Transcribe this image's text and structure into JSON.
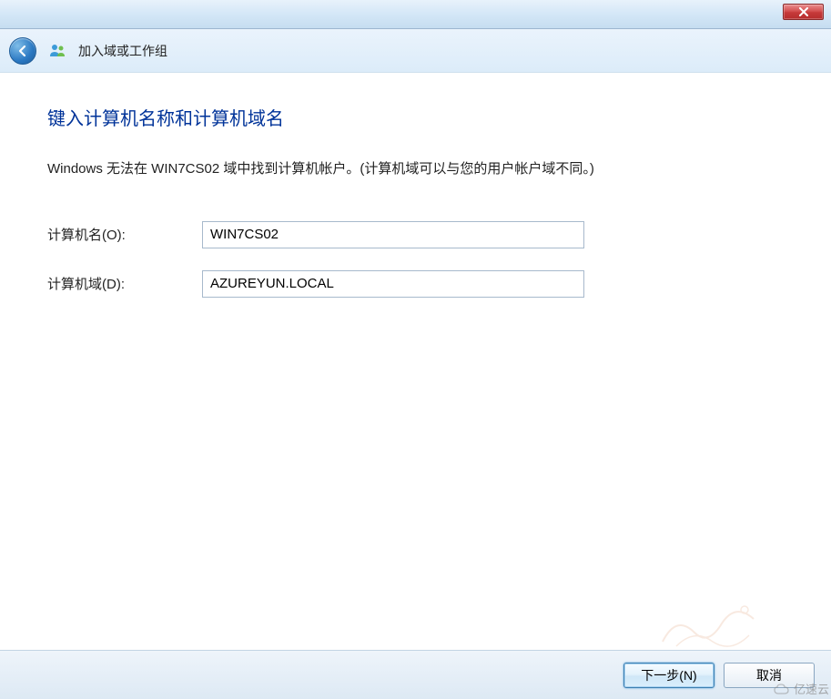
{
  "window": {
    "title": "加入域或工作组"
  },
  "page": {
    "heading": "键入计算机名称和计算机域名",
    "description": "Windows 无法在 WIN7CS02 域中找到计算机帐户。(计算机域可以与您的用户帐户域不同。)"
  },
  "form": {
    "computer_name_label": "计算机名(O):",
    "computer_name_value": "WIN7CS02",
    "computer_domain_label": "计算机域(D):",
    "computer_domain_value": "AZUREYUN.LOCAL"
  },
  "buttons": {
    "next": "下一步(N)",
    "cancel": "取消"
  },
  "watermark": "亿速云"
}
